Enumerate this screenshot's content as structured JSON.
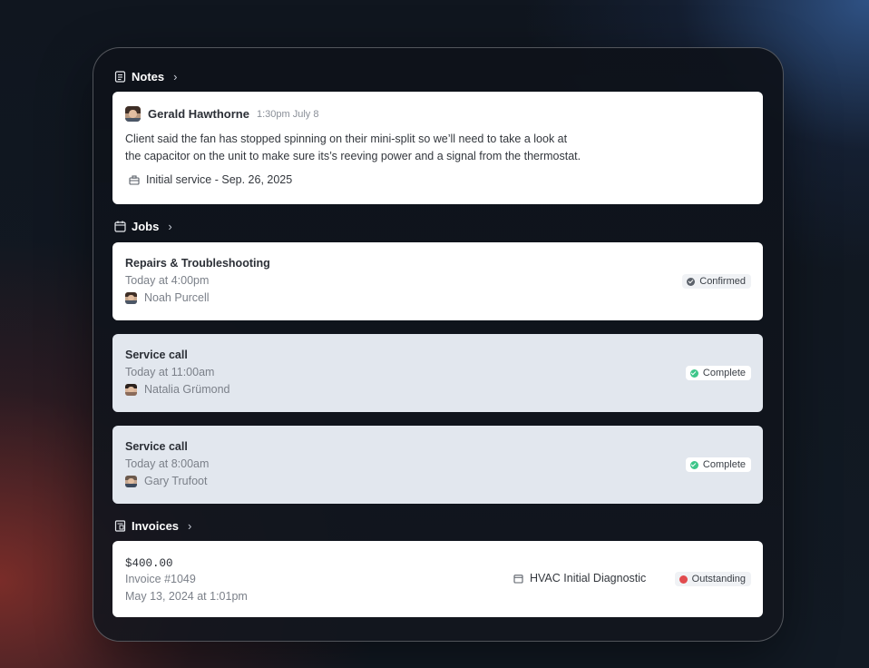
{
  "notes": {
    "section_label": "Notes",
    "author": "Gerald Hawthorne",
    "time": "1:30pm July 8",
    "body_line1": "Client said the fan has stopped spinning on their mini-split so we’ll need to take a look at",
    "body_line2": "the capacitor on the unit to make sure its’s reeving power and a signal from the thermostat.",
    "tag": "Initial service - Sep. 26, 2025"
  },
  "jobs": {
    "section_label": "Jobs",
    "items": [
      {
        "title": "Repairs & Troubleshooting",
        "time": "Today at 4:00pm",
        "person": "Noah Purcell",
        "status": "Confirmed",
        "status_color": "#5d636c"
      },
      {
        "title": "Service call",
        "time": "Today at 11:00am",
        "person": "Natalia Grümond",
        "status": "Complete",
        "status_color": "#3ec68a"
      },
      {
        "title": "Service call",
        "time": "Today at 8:00am",
        "person": "Gary Trufoot",
        "status": "Complete",
        "status_color": "#3ec68a"
      }
    ]
  },
  "invoices": {
    "section_label": "Invoices",
    "items": [
      {
        "amount": "$400.00",
        "number": "Invoice #1049",
        "date": "May 13, 2024 at 1:01pm",
        "service": "HVAC Initial Diagnostic",
        "status": "Outstanding",
        "status_color": "#e14b4e"
      }
    ]
  },
  "icons": {
    "notes": "notes-icon",
    "jobs": "calendar-icon",
    "invoices": "invoice-icon",
    "chevron": "chevron-right-icon",
    "tag": "toolbox-icon"
  }
}
